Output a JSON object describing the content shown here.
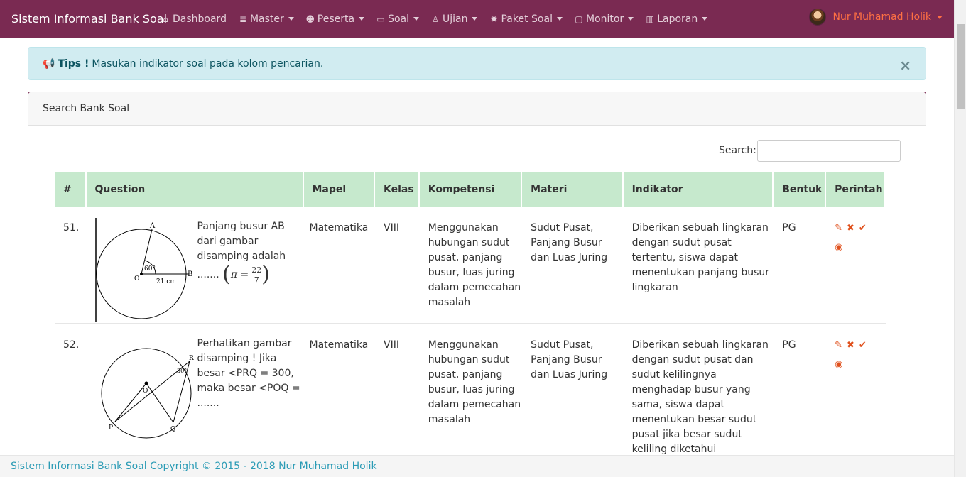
{
  "navbar": {
    "brand": "Sistem Informasi Bank Soal",
    "items": [
      {
        "label": "Dashboard",
        "icon": "home-icon",
        "dropdown": false
      },
      {
        "label": "Master",
        "icon": "database-icon",
        "dropdown": true
      },
      {
        "label": "Peserta",
        "icon": "users-icon",
        "dropdown": true
      },
      {
        "label": "Soal",
        "icon": "desktop-icon",
        "dropdown": true
      },
      {
        "label": "Ujian",
        "icon": "award-icon",
        "dropdown": true
      },
      {
        "label": "Paket Soal",
        "icon": "gear-icon",
        "dropdown": true
      },
      {
        "label": "Monitor",
        "icon": "tv-icon",
        "dropdown": true
      },
      {
        "label": "Laporan",
        "icon": "bar-chart-icon",
        "dropdown": true
      }
    ],
    "user": "Nur Muhamad Holik"
  },
  "alert": {
    "title": "Tips !",
    "message": "Masukan indikator soal pada kolom pencarian.",
    "close": "×"
  },
  "card": {
    "title": "Search Bank Soal",
    "search_label": "Search:",
    "search_value": ""
  },
  "table": {
    "headers": [
      "#",
      "Question",
      "Mapel",
      "Kelas",
      "Kompetensi",
      "Materi",
      "Indikator",
      "Bentuk",
      "Perintah"
    ],
    "rows": [
      {
        "no": "51.",
        "question": "Panjang busur AB dari gambar disamping adalah .......",
        "formula_lhs": "π =",
        "formula_num": "22",
        "formula_den": "7",
        "fig": {
          "angle": "60°",
          "radius": "21 cm",
          "A": "A",
          "B": "B",
          "O": "O"
        },
        "mapel": "Matematika",
        "kelas": "VIII",
        "kompetensi": "Menggunakan hubungan sudut pusat, panjang busur, luas juring dalam pemecahan masalah",
        "materi": "Sudut Pusat, Panjang Busur dan Luas Juring",
        "indikator": "Diberikan sebuah lingkaran dengan sudut pusat tertentu, siswa dapat menentukan panjang busur lingkaran",
        "bentuk": "PG"
      },
      {
        "no": "52.",
        "question": "Perhatikan gambar disamping ! Jika besar <PRQ = 300, maka besar <POQ = .......",
        "fig": {
          "angle": "30°",
          "P": "P",
          "Q": "Q",
          "R": "R",
          "O": "O"
        },
        "mapel": "Matematika",
        "kelas": "VIII",
        "kompetensi": "Menggunakan hubungan sudut pusat, panjang busur, luas juring dalam pemecahan masalah",
        "materi": "Sudut Pusat, Panjang Busur dan Luas Juring",
        "indikator": "Diberikan sebuah lingkaran dengan sudut pusat dan sudut kelilingnya menghadap busur yang sama, siswa dapat menentukan besar sudut pusat jika besar sudut keliling diketahui",
        "bentuk": "PG"
      }
    ]
  },
  "footer": {
    "text": "Sistem Informasi Bank Soal Copyright © 2015 - 2018 Nur Muhamad Holik"
  },
  "colors": {
    "navbar": "#7a2a52",
    "header_row": "#c6e9cd",
    "action": "#e0501c",
    "user": "#ff7043",
    "footer_text": "#2a9bb5"
  }
}
